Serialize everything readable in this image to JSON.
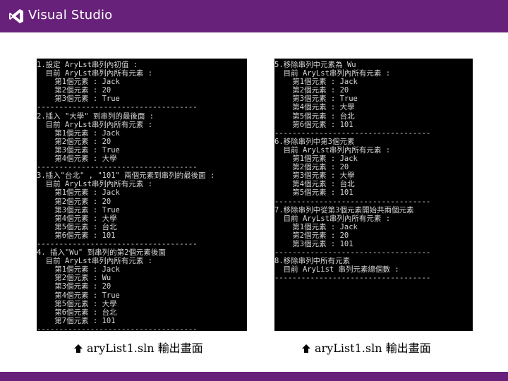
{
  "header": {
    "brand": "Visual Studio",
    "accent": "#68217a",
    "logo_icon": "visual-studio-logo-icon"
  },
  "consoles": {
    "left": {
      "lines": [
        "1.設定 AryLst串列內初值 :",
        "  目前 AryLst串列內所有元素 :",
        "    第1個元素 : Jack",
        "    第2個元素 : 20",
        "    第3個元素 : True",
        "------------------------------------",
        "2.插入 \"大學\" 到串列的最後面 :",
        "  目前 AryLst串列內所有元素 :",
        "    第1個元素 : Jack",
        "    第2個元素 : 20",
        "    第3個元素 : True",
        "    第4個元素 : 大學",
        "------------------------------------",
        "3.插入\"台北\" , \"101\" 兩個元素到串列的最後面 :",
        "  目前 AryLst串列內所有元素 :",
        "    第1個元素 : Jack",
        "    第2個元素 : 20",
        "    第3個元素 : True",
        "    第4個元素 : 大學",
        "    第5個元素 : 台北",
        "    第6個元素 : 101",
        "------------------------------------",
        "4. 插入\"Wu\" 到串列的第2個元素後面",
        "  目前 AryLst串列內所有元素 :",
        "    第1個元素 : Jack",
        "    第2個元素 : Wu",
        "    第3個元素 : 20",
        "    第4個元素 : True",
        "    第5個元素 : 大學",
        "    第6個元素 : 台北",
        "    第7個元素 : 101",
        "------------------------------------"
      ]
    },
    "right": {
      "lines": [
        "5.移除串列中元素為 Wu",
        "  目前 AryLst串列內所有元素 :",
        "    第1個元素 : Jack",
        "    第2個元素 : 20",
        "    第3個元素 : True",
        "    第4個元素 : 大學",
        "    第5個元素 : 台北",
        "    第6個元素 : 101",
        "-----------------------------------",
        "6.移除串列中第3個元素",
        "  目前 AryLst串列內所有元素 :",
        "    第1個元素 : Jack",
        "    第2個元素 : 20",
        "    第3個元素 : 大學",
        "    第4個元素 : 台北",
        "    第5個元素 : 101",
        "-----------------------------------",
        "7.移除串列中從第3個元素開始共兩個元素",
        "  目前 AryLst串列內所有元素 :",
        "    第1個元素 : Jack",
        "    第2個元素 : 20",
        "    第3個元素 : 101",
        "-----------------------------------",
        "8.移除串列中所有元素",
        "  目前 AryList 串列元素總個數 :",
        "-----------------------------------"
      ]
    }
  },
  "captions": {
    "left": "aryList1.sln 輸出畫面",
    "right": "aryList1.sln 輸出畫面",
    "icon": "up-arrow-icon"
  }
}
